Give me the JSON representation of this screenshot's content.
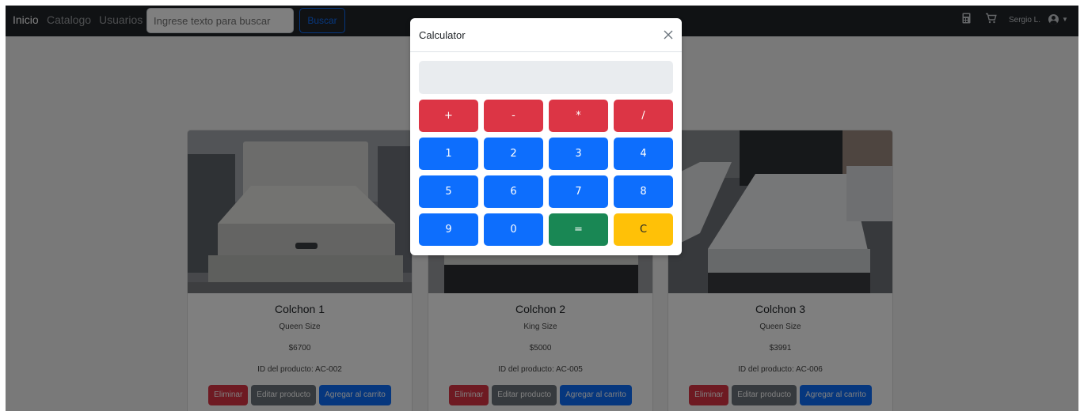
{
  "nav": {
    "links": [
      "Inicio",
      "Catalogo",
      "Usuarios"
    ],
    "search_placeholder": "Ingrese texto para buscar",
    "search_button": "Buscar",
    "icons": [
      "calculator-icon",
      "cart-icon",
      "user-avatar-icon"
    ],
    "user": "Sergio L."
  },
  "products": [
    {
      "name": "Colchon 1",
      "size": "Queen Size",
      "price": "$6700",
      "id": "ID del producto: AC-002"
    },
    {
      "name": "Colchon 2",
      "size": "King Size",
      "price": "$5000",
      "id": "ID del producto: AC-005"
    },
    {
      "name": "Colchon 3",
      "size": "Queen Size",
      "price": "$3991",
      "id": "ID del producto: AC-006"
    }
  ],
  "card_buttons": {
    "delete": "Eliminar",
    "edit": "Editar producto",
    "cart": "Agregar al carrito"
  },
  "modal": {
    "title": "Calculator",
    "display_value": "",
    "keys": [
      [
        "+",
        "-",
        "*",
        "/"
      ],
      [
        "1",
        "2",
        "3",
        "4"
      ],
      [
        "5",
        "6",
        "7",
        "8"
      ],
      [
        "9",
        "0",
        "=",
        "C"
      ]
    ]
  },
  "colors": {
    "navbar": "#212529",
    "danger": "#dc3545",
    "primary": "#0d6efd",
    "secondary": "#6c757d",
    "success": "#198754",
    "warning": "#ffc107"
  }
}
